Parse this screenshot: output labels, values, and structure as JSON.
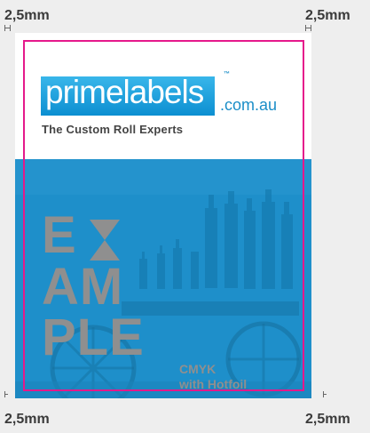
{
  "bleed": {
    "top_left": "2,5mm",
    "top_right": "2,5mm",
    "bottom_left": "2,5mm",
    "bottom_right": "2,5mm"
  },
  "logo": {
    "brand": "primelabels",
    "domain": ".com.au",
    "trademark": "™",
    "tagline": "The Custom Roll Experts"
  },
  "example": {
    "line1": "E",
    "line2": "AM",
    "line3": "PLE",
    "note_line1": "CMYK",
    "note_line2": "with Hotfoil"
  },
  "colors": {
    "trim_line": "#e5198b",
    "brand_blue": "#1b8ec8",
    "example_grey": "#8f8f8f"
  }
}
